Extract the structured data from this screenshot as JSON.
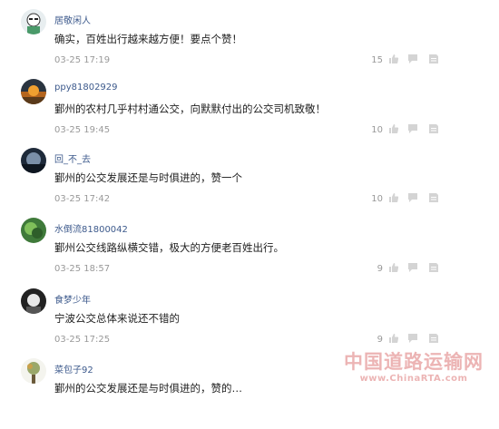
{
  "comments": [
    {
      "user": "居敬闲人",
      "text": "确实，百姓出行越来越方便！要点个赞！",
      "time": "03-25 17:19",
      "likes": "15"
    },
    {
      "user": "ppy81802929",
      "text": "鄞州的农村几乎村村通公交，向默默付出的公交司机致敬！",
      "time": "03-25 19:45",
      "likes": "10"
    },
    {
      "user": "回_不_去",
      "text": "鄞州的公交发展还是与时俱进的，赞一个",
      "time": "03-25 17:42",
      "likes": "10"
    },
    {
      "user": "水倒流81800042",
      "text": "鄞州公交线路纵横交错，极大的方便老百姓出行。",
      "time": "03-25 18:57",
      "likes": "9"
    },
    {
      "user": "食梦少年",
      "text": "宁波公交总体来说还不错的",
      "time": "03-25 17:25",
      "likes": "9"
    },
    {
      "user": "菜包子92",
      "text": "鄞州的公交发展还是与时俱进的，赞的…",
      "time": "",
      "likes": ""
    }
  ],
  "icons": {
    "like": "thumbs-up-icon",
    "reply": "reply-icon",
    "more": "more-options-icon"
  },
  "colors": {
    "username": "#3d5a8c",
    "meta": "#999999",
    "watermark": "#c82828"
  },
  "watermark": {
    "title": "中国道路运输网",
    "url": "www.ChinaRTA.com"
  }
}
